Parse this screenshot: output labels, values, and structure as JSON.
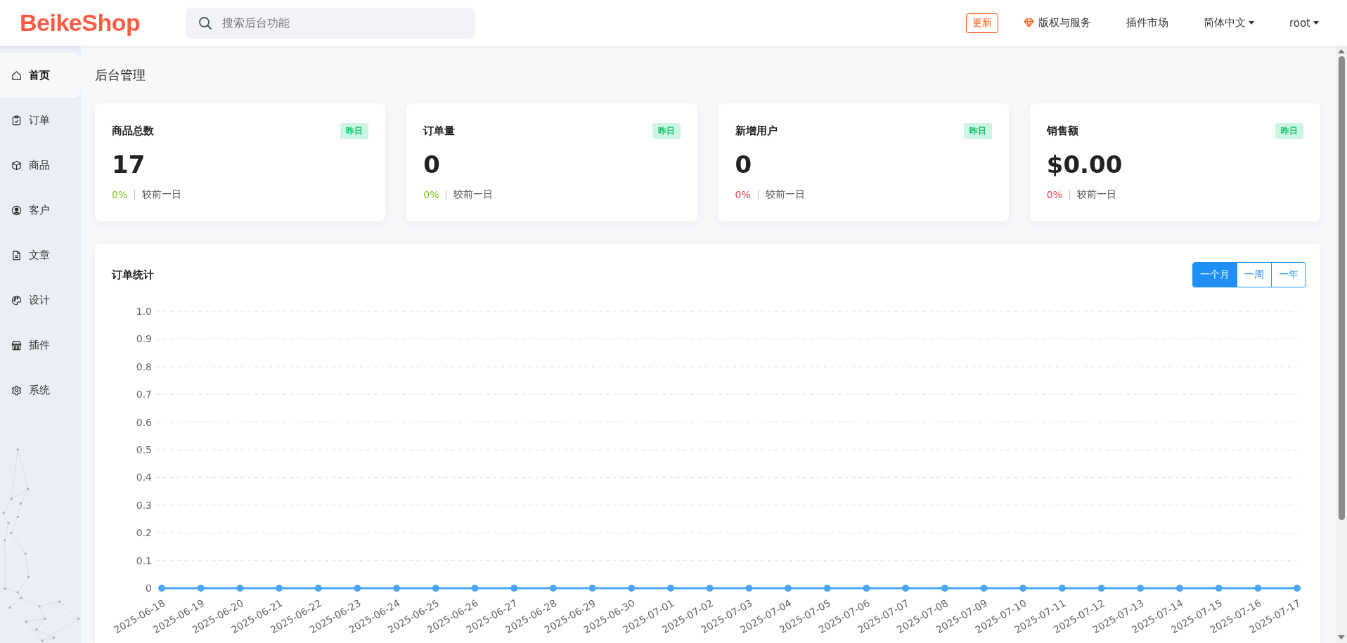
{
  "header": {
    "logo": "BeikeShop",
    "search": {
      "placeholder": "搜索后台功能"
    },
    "update_button": "更新",
    "nav": [
      {
        "label": "版权与服务",
        "kind": "service"
      },
      {
        "label": "插件市场",
        "kind": "link"
      },
      {
        "label": "简体中文",
        "kind": "dropdown"
      },
      {
        "label": "root",
        "kind": "dropdown"
      }
    ]
  },
  "sidebar": {
    "items": [
      {
        "label": "首页",
        "selected": true
      },
      {
        "label": "订单",
        "selected": false
      },
      {
        "label": "商品",
        "selected": false
      },
      {
        "label": "客户",
        "selected": false
      },
      {
        "label": "文章",
        "selected": false
      },
      {
        "label": "设计",
        "selected": false
      },
      {
        "label": "插件",
        "selected": false
      },
      {
        "label": "系统",
        "selected": false
      }
    ]
  },
  "page_title": "后台管理",
  "stats": [
    {
      "title": "商品总数",
      "badge": "昨日",
      "value": "17",
      "change": "0%",
      "color": "#7ac41a",
      "compare": "较前一日"
    },
    {
      "title": "订单量",
      "badge": "昨日",
      "value": "0",
      "change": "0%",
      "color": "#7ac41a",
      "compare": "较前一日"
    },
    {
      "title": "新增用户",
      "badge": "昨日",
      "value": "0",
      "change": "0%",
      "color": "#e9414a",
      "compare": "较前一日"
    },
    {
      "title": "销售额",
      "badge": "昨日",
      "value": "$0.00",
      "change": "0%",
      "color": "#e9414a",
      "compare": "较前一日"
    }
  ],
  "order_chart": {
    "title": "订单统计",
    "ranges": [
      {
        "label": "一个月",
        "selected": true
      },
      {
        "label": "一周",
        "selected": false
      },
      {
        "label": "一年",
        "selected": false
      }
    ],
    "chart_data": {
      "type": "line",
      "categories": [
        "2025-06-18",
        "2025-06-19",
        "2025-06-20",
        "2025-06-21",
        "2025-06-22",
        "2025-06-23",
        "2025-06-24",
        "2025-06-25",
        "2025-06-26",
        "2025-06-27",
        "2025-06-28",
        "2025-06-29",
        "2025-06-30",
        "2025-07-01",
        "2025-07-02",
        "2025-07-03",
        "2025-07-04",
        "2025-07-05",
        "2025-07-06",
        "2025-07-07",
        "2025-07-08",
        "2025-07-09",
        "2025-07-10",
        "2025-07-11",
        "2025-07-12",
        "2025-07-13",
        "2025-07-14",
        "2025-07-15",
        "2025-07-16",
        "2025-07-17"
      ],
      "grid": true,
      "series": [
        {
          "color": "#4aa5f5",
          "marker": true,
          "values": [
            0,
            0,
            0,
            0,
            0,
            0,
            0,
            0,
            0,
            0,
            0,
            0,
            0,
            0,
            0,
            0,
            0,
            0,
            0,
            0,
            0,
            0,
            0,
            0,
            0,
            0,
            0,
            0,
            0,
            0
          ]
        }
      ],
      "ylim": [
        0,
        1
      ],
      "yticks": [
        {
          "value": 0,
          "label": "0"
        },
        {
          "value": 0.1,
          "label": "0.1"
        },
        {
          "value": 0.2,
          "label": "0.2"
        },
        {
          "value": 0.3,
          "label": "0.3"
        },
        {
          "value": 0.4,
          "label": "0.4"
        },
        {
          "value": 0.5,
          "label": "0.5"
        },
        {
          "value": 0.6,
          "label": "0.6"
        },
        {
          "value": 0.7,
          "label": "0.7"
        },
        {
          "value": 0.8,
          "label": "0.8"
        },
        {
          "value": 0.9,
          "label": "0.9"
        },
        {
          "value": 1,
          "label": "1.0"
        }
      ]
    }
  }
}
